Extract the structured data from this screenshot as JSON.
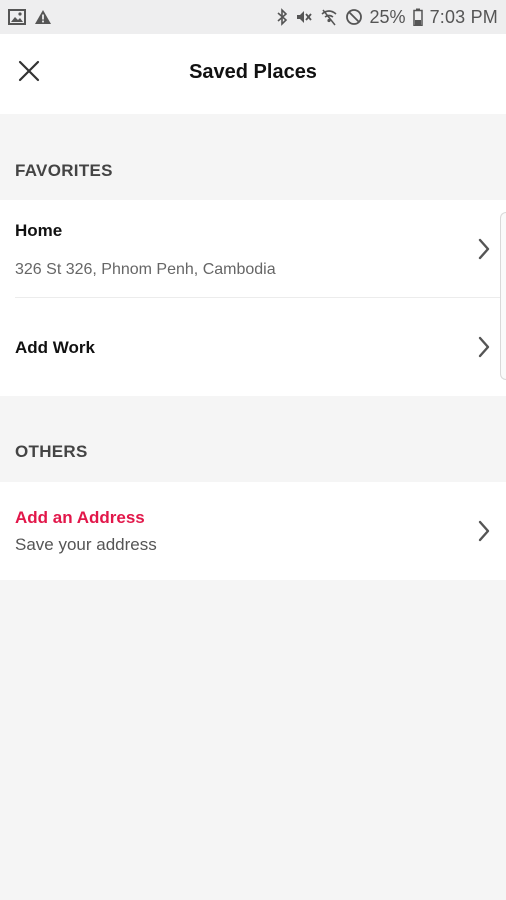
{
  "status_bar": {
    "battery_percent": "25%",
    "time": "7:03 PM",
    "left_icons": [
      "image-icon",
      "warning-icon"
    ],
    "right_icons": [
      "bluetooth-icon",
      "mute-icon",
      "wifi-off-icon",
      "do-not-disturb-icon",
      "battery-icon"
    ]
  },
  "header": {
    "title": "Saved Places",
    "close_icon": "close-icon"
  },
  "favorites": {
    "label": "FAVORITES",
    "items": [
      {
        "title": "Home",
        "subtitle": "326 St 326, Phnom Penh, Cambodia"
      },
      {
        "title": "Add Work"
      }
    ]
  },
  "others": {
    "label": "OTHERS",
    "items": [
      {
        "title": "Add an Address",
        "subtitle": "Save your address"
      }
    ]
  },
  "colors": {
    "accent": "#e2174a",
    "background": "#f5f5f5",
    "card": "#ffffff",
    "status_bar": "#eeeeef"
  }
}
